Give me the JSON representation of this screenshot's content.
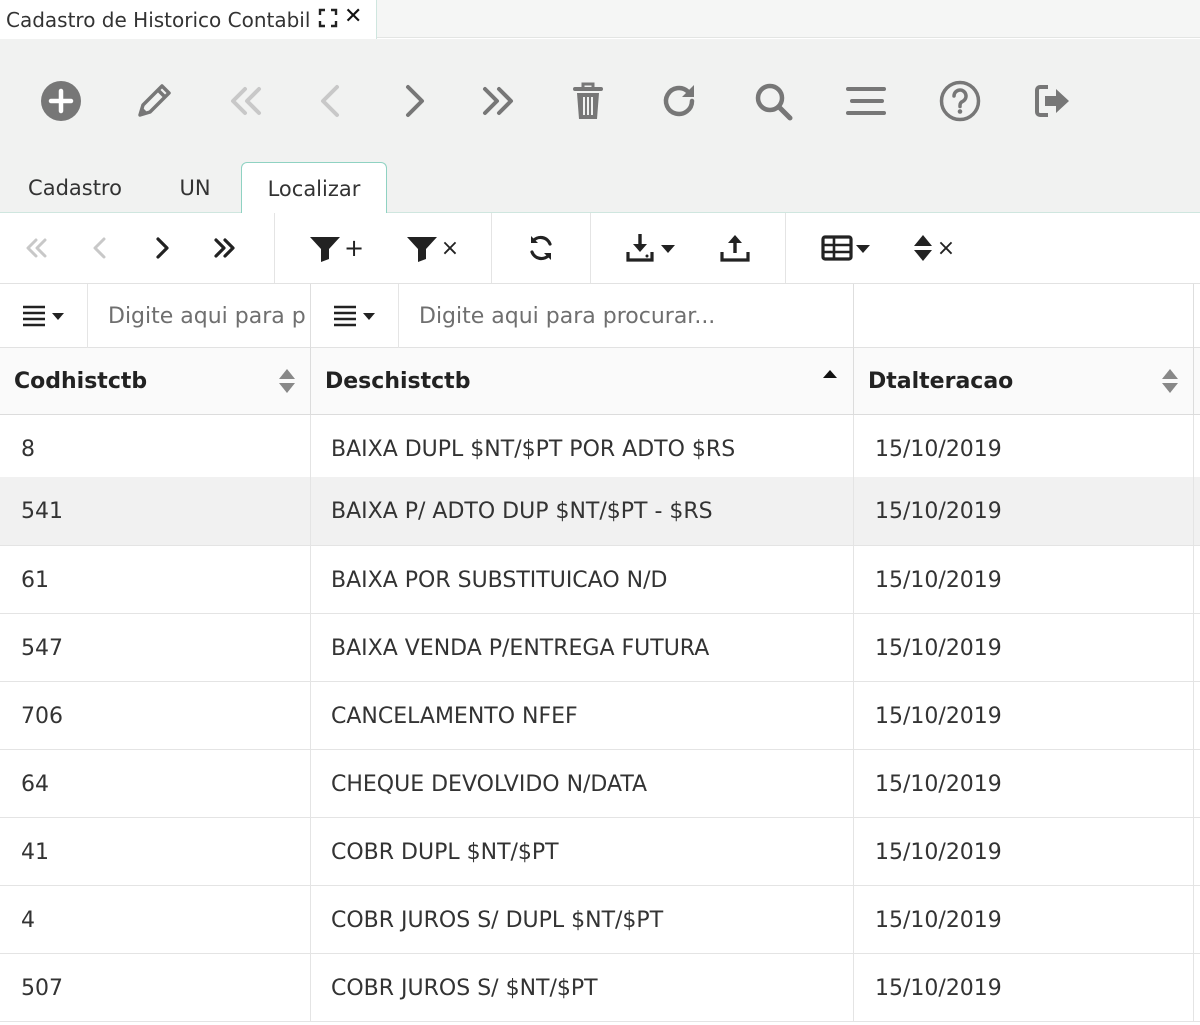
{
  "window": {
    "title": "Cadastro de Historico Contabil",
    "close_glyph": "✕"
  },
  "toolbar": {
    "icons": [
      "add-icon",
      "edit-icon",
      "first-icon",
      "previous-icon",
      "next-icon",
      "last-icon",
      "delete-icon",
      "refresh-icon",
      "search-icon",
      "menu-icon",
      "help-icon",
      "exit-icon"
    ]
  },
  "tabs": [
    {
      "label": "Cadastro"
    },
    {
      "label": "UN"
    },
    {
      "label": "Localizar"
    }
  ],
  "grid_toolbar": {
    "filter_add_glyph": "+",
    "filter_clear_glyph": "×",
    "sort_clear_glyph": "×"
  },
  "filters": {
    "col1_placeholder": "Digite aqui para procurar...",
    "col2_placeholder": "Digite aqui para procurar..."
  },
  "columns": [
    {
      "label": "Codhistctb"
    },
    {
      "label": "Deschistctb"
    },
    {
      "label": "Dtalteracao"
    }
  ],
  "rows": [
    {
      "code": "8",
      "desc": "BAIXA DUPL $NT/$PT POR ADTO $RS",
      "date": "15/10/2019"
    },
    {
      "code": "541",
      "desc": "BAIXA P/ ADTO DUP $NT/$PT - $RS",
      "date": "15/10/2019"
    },
    {
      "code": "61",
      "desc": "BAIXA POR SUBSTITUICAO N/D",
      "date": "15/10/2019"
    },
    {
      "code": "547",
      "desc": "BAIXA VENDA P/ENTREGA FUTURA",
      "date": "15/10/2019"
    },
    {
      "code": "706",
      "desc": "CANCELAMENTO NFEF",
      "date": "15/10/2019"
    },
    {
      "code": "64",
      "desc": "CHEQUE DEVOLVIDO N/DATA",
      "date": "15/10/2019"
    },
    {
      "code": "41",
      "desc": "COBR DUPL $NT/$PT",
      "date": "15/10/2019"
    },
    {
      "code": "4",
      "desc": "COBR JUROS S/ DUPL $NT/$PT",
      "date": "15/10/2019"
    },
    {
      "code": "507",
      "desc": "COBR JUROS S/ $NT/$PT",
      "date": "15/10/2019"
    }
  ],
  "colors": {
    "accent": "#8fd2c2",
    "toolbar_bg": "#f1f2f1",
    "icon_enabled": "#777777",
    "icon_disabled": "#c8c8c8"
  }
}
